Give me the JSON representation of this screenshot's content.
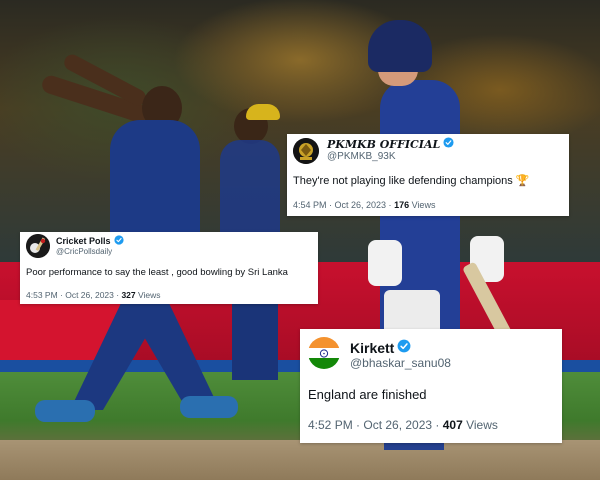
{
  "colors": {
    "verified_blue": "#1d9bf0",
    "text_primary": "#0f1419",
    "text_secondary": "#536471",
    "card_background": "#ffffff"
  },
  "tweets": [
    {
      "id": "pkmkb",
      "display_name": "PKMKB OFFICIAL",
      "handle": "@PKMKB_93K",
      "verified": true,
      "avatar_icon": "pkmkb-logo-icon",
      "text": "They're not playing like defending champions",
      "emoji": "🏆",
      "time": "4:54 PM · Oct 26, 2023 · ",
      "views_count": "176",
      "views_label": " Views"
    },
    {
      "id": "cricpolls",
      "display_name": "Cricket Polls",
      "handle": "@CricPollsdaily",
      "verified": true,
      "avatar_icon": "cricket-polls-logo-icon",
      "text": "Poor performance to say the least , good bowling by Sri Lanka",
      "time": "4:53 PM · Oct 26, 2023 · ",
      "views_count": "327",
      "views_label": " Views"
    },
    {
      "id": "kirkett",
      "display_name": "Kirkett",
      "handle": "@bhaskar_sanu08",
      "verified": true,
      "avatar_icon": "india-flag-icon",
      "text": "England are finished",
      "time": "4:52 PM · Oct 26, 2023 · ",
      "views_count": "407",
      "views_label": " Views"
    }
  ]
}
